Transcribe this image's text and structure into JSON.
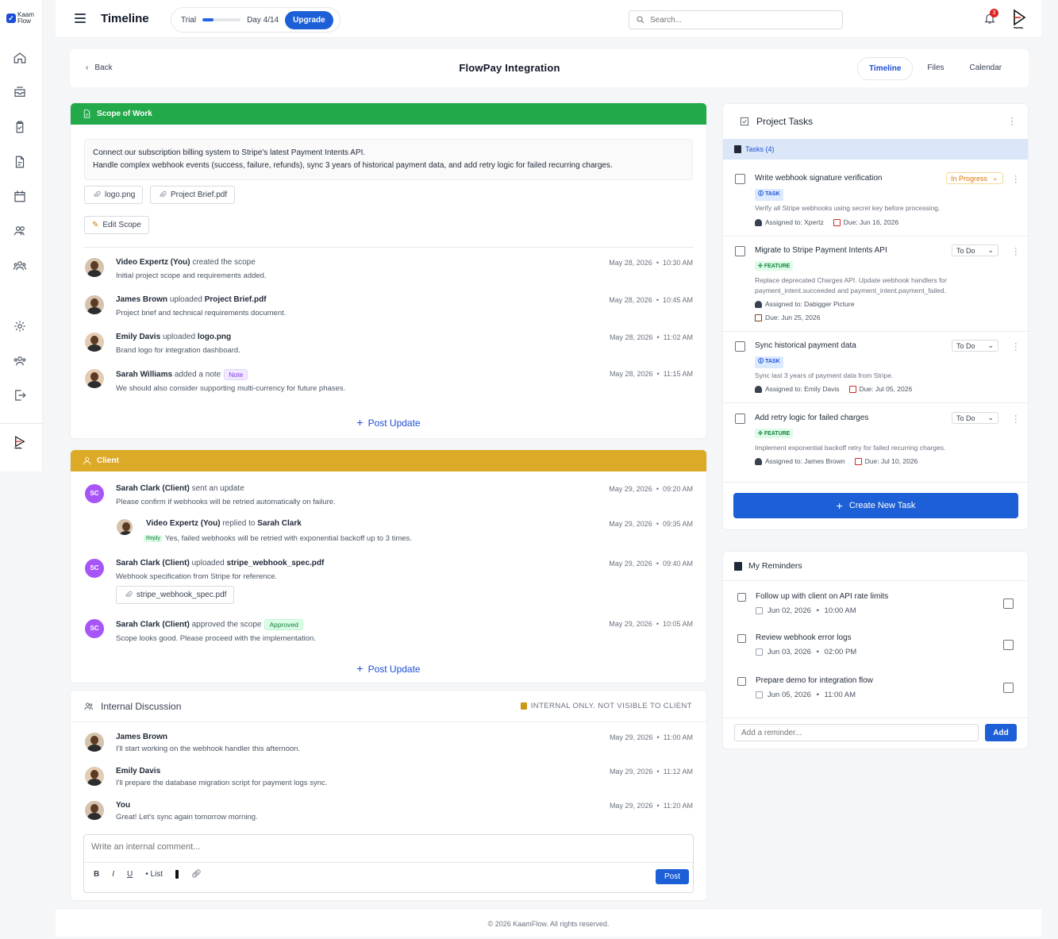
{
  "sidebar": {
    "logo": {
      "line1": "Kaam",
      "line2": "Flow"
    },
    "icons": [
      "home-icon",
      "inbox-icon",
      "clipboard-check-icon",
      "document-icon",
      "calendar-icon",
      "users-icon",
      "team-icon",
      "settings-icon",
      "team-alt-icon",
      "logout-icon",
      "brand-icon"
    ]
  },
  "topbar": {
    "title": "Timeline",
    "trial_label": "Trial",
    "trial_progress": 0.29,
    "trial_day": "Day 4/14",
    "upgrade_label": "Upgrade",
    "search_placeholder": "Search...",
    "notification_count": "3"
  },
  "header": {
    "back_label": "Back",
    "page_title": "FlowPay Integration",
    "tabs": [
      "Timeline",
      "Files",
      "Calendar"
    ],
    "active_tab": "Timeline"
  },
  "scope": {
    "title": "Scope of Work",
    "color": "#22a94a",
    "text_line1": "Connect our subscription billing system to Stripe's latest Payment Intents API.",
    "text_line2": "Handle complex webhook events (success, failure, refunds), sync 3 years of historical payment data, and add retry logic for failed recurring charges.",
    "files": [
      "logo.png",
      "Project Brief.pdf"
    ],
    "edit_label": "Edit Scope",
    "activities": [
      {
        "name": "Video Expertz (You)",
        "action": "created the scope",
        "object": "",
        "sub": "Initial project scope and requirements added.",
        "date": "May 28, 2026",
        "time": "10:30 AM"
      },
      {
        "name": "James Brown",
        "action": "uploaded",
        "object": "Project Brief.pdf",
        "sub": "Project brief and technical requirements document.",
        "date": "May 28, 2026",
        "time": "10:45 AM"
      },
      {
        "name": "Emily Davis",
        "action": "uploaded",
        "object": "logo.png",
        "sub": "Brand logo for integration dashboard.",
        "date": "May 28, 2026",
        "time": "11:02 AM"
      },
      {
        "name": "Sarah Williams",
        "action": "added a note",
        "object": "",
        "tag": "Note",
        "sub": "We should also consider supporting multi-currency for future phases.",
        "date": "May 28, 2026",
        "time": "11:15 AM"
      }
    ],
    "post_update_label": "Post Update"
  },
  "client": {
    "title": "Client",
    "color": "#dcaa26",
    "activities": [
      {
        "initials": "SC",
        "name": "Sarah Clark (Client)",
        "action": "sent an update",
        "object": "",
        "sub": "Please confirm if webhooks will be retried automatically on failure.",
        "date": "May 29, 2026",
        "time": "09:20 AM"
      },
      {
        "name": "Video Expertz (You)",
        "action": "replied to",
        "object": "Sarah Clark",
        "reply_tag": "Reply",
        "sub": "Yes, failed webhooks will be retried with exponential backoff up to 3 times.",
        "date": "May 29, 2026",
        "time": "09:35 AM"
      },
      {
        "initials": "SC",
        "name": "Sarah Clark (Client)",
        "action": "uploaded",
        "object": "stripe_webhook_spec.pdf",
        "sub": "Webhook specification from Stripe for reference.",
        "file": "stripe_webhook_spec.pdf",
        "date": "May 29, 2026",
        "time": "09:40 AM"
      },
      {
        "initials": "SC",
        "name": "Sarah Clark (Client)",
        "action": "approved the scope",
        "object": "",
        "tag": "Approved",
        "sub": "Scope looks good. Please proceed with the implementation.",
        "date": "May 29, 2026",
        "time": "10:05 AM"
      }
    ],
    "post_update_label": "Post Update"
  },
  "discussion": {
    "title": "Internal Discussion",
    "internal_note": "INTERNAL ONLY. NOT VISIBLE TO CLIENT",
    "messages": [
      {
        "name": "James Brown",
        "text": "I'll start working on the webhook handler this afternoon.",
        "date": "May 29, 2026",
        "time": "11:00 AM"
      },
      {
        "name": "Emily Davis",
        "text": "I'll prepare the database migration script for payment logs sync.",
        "date": "May 29, 2026",
        "time": "11:12 AM"
      },
      {
        "name": "You",
        "text": "Great! Let's sync again tomorrow morning.",
        "date": "May 29, 2026",
        "time": "11:20 AM"
      }
    ],
    "placeholder": "Write an internal comment...",
    "toolbar": [
      "B",
      "I",
      "U",
      "• List"
    ],
    "post_label": "Post"
  },
  "tasks": {
    "title": "Project Tasks",
    "count_label": "Tasks (4)",
    "items": [
      {
        "title": "Write webhook signature verification",
        "status": "In Progress",
        "type": "TASK",
        "desc": "Verify all Stripe webhooks using secret key before processing.",
        "assigned": "Assigned to: Xpertz",
        "due": "Due: Jun 16, 2026"
      },
      {
        "title": "Migrate to Stripe Payment Intents API",
        "status": "To Do",
        "type": "FEATURE",
        "desc": "Replace deprecated Charges API. Update webhook handlers for payment_intent.succeeded and payment_intent.payment_failed.",
        "assigned": "Assigned to: Dabigger Picture",
        "due": "Due: Jun 25, 2026"
      },
      {
        "title": "Sync historical payment data",
        "status": "To Do",
        "type": "TASK",
        "desc": "Sync last 3 years of payment data from Stripe.",
        "assigned": "Assigned to: Emily Davis",
        "due": "Due: Jul 05, 2026"
      },
      {
        "title": "Add retry logic for failed charges",
        "status": "To Do",
        "type": "FEATURE",
        "desc": "Implement exponential backoff retry for failed recurring charges.",
        "assigned": "Assigned to: James Brown",
        "due": "Due: Jul 10, 2026"
      }
    ],
    "create_label": "Create New Task"
  },
  "reminders": {
    "title": "My Reminders",
    "items": [
      {
        "title": "Follow up with client on API rate limits",
        "date": "Jun 02, 2026",
        "time": "10:00 AM"
      },
      {
        "title": "Review webhook error logs",
        "date": "Jun 03, 2026",
        "time": "02:00 PM"
      },
      {
        "title": "Prepare demo for integration flow",
        "date": "Jun 05, 2026",
        "time": "11:00 AM"
      }
    ],
    "input_placeholder": "Add a reminder...",
    "add_label": "Add"
  },
  "footer": {
    "text": "© 2026 KaamFlow. All rights reserved."
  }
}
